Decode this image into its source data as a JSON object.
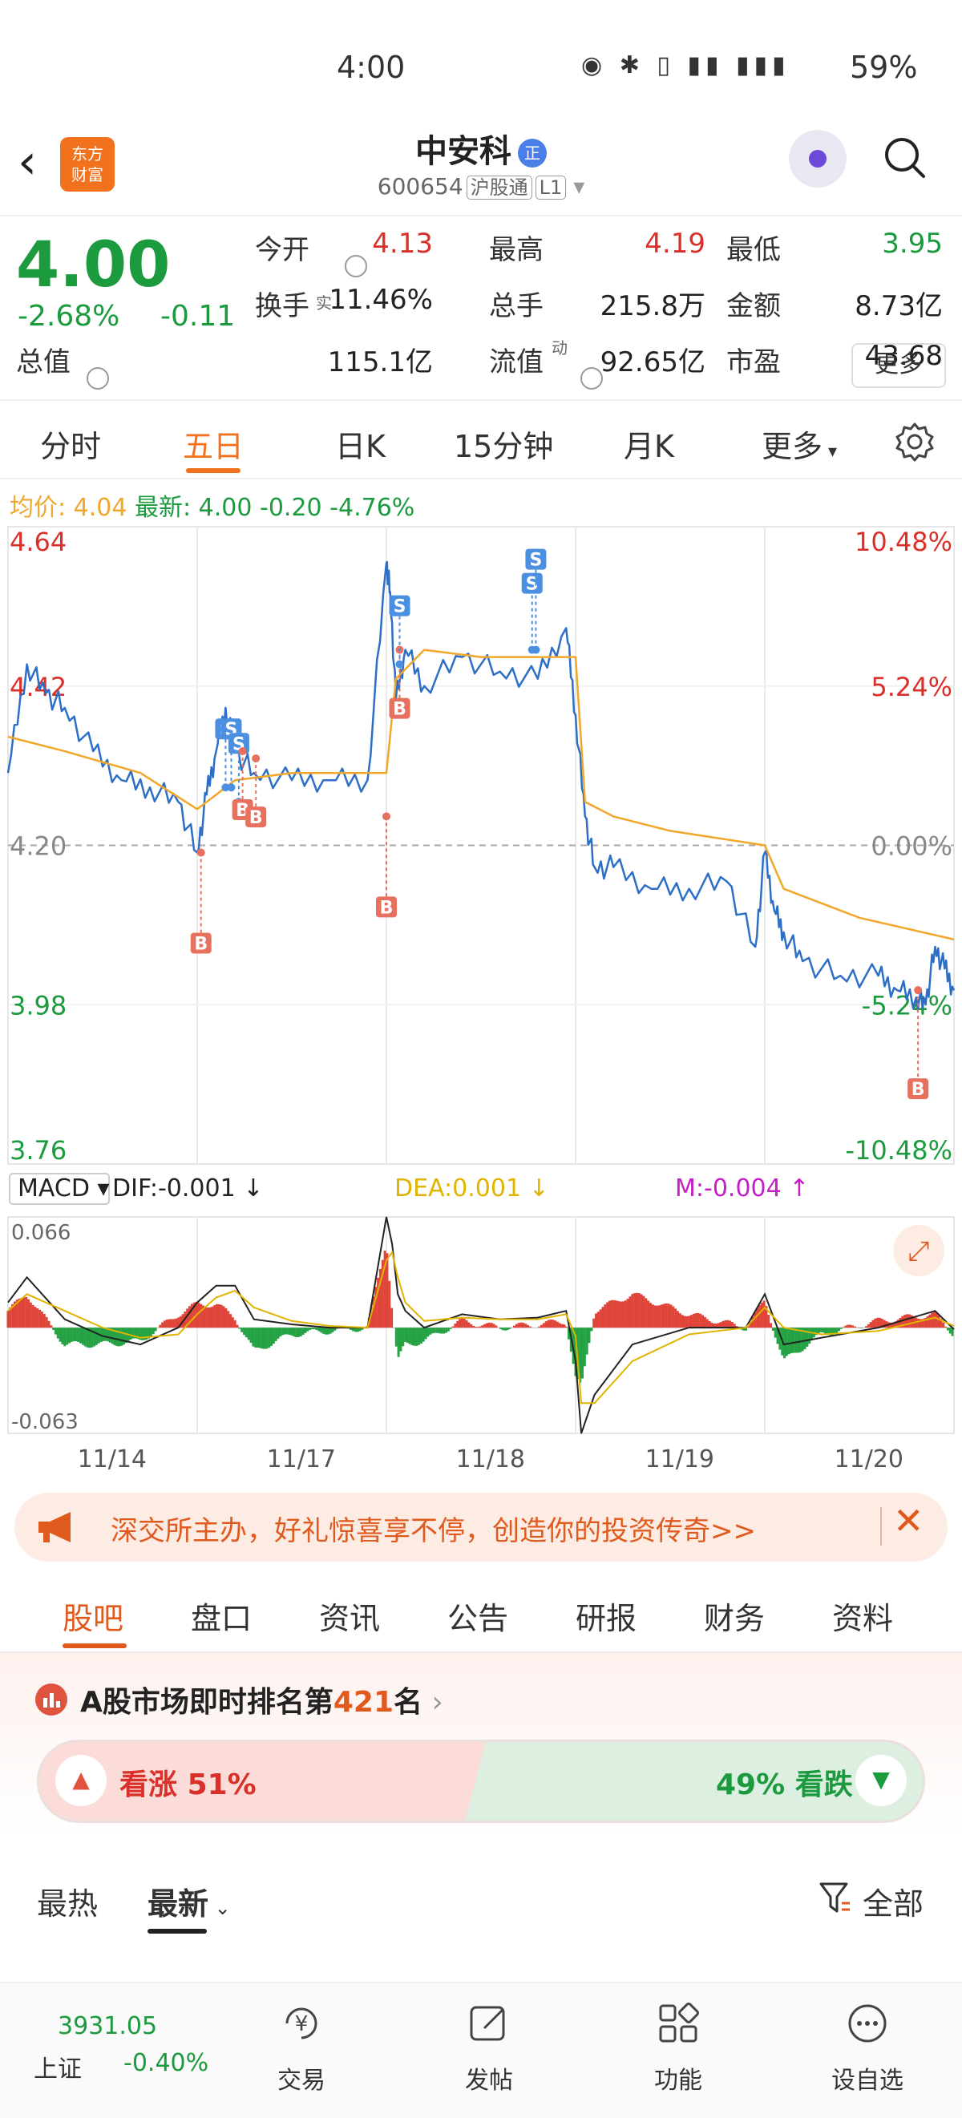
{
  "status_bar": {
    "time": "4:00",
    "icons": "◉ ✱ ▯ ▮▮ ▮▮▮",
    "battery": "59%"
  },
  "header": {
    "logo_line1": "东方",
    "logo_line2": "财富",
    "title": "中安科",
    "title_badge": "正",
    "code": "600654",
    "tag1": "沪股通",
    "tag2": "L1"
  },
  "quote": {
    "price": "4.00",
    "change_pct": "-2.68%",
    "change": "-0.11",
    "fields": [
      {
        "label": "今开",
        "value": "4.13",
        "color": "red"
      },
      {
        "label": "最高",
        "value": "4.19",
        "color": "red"
      },
      {
        "label": "最低",
        "value": "3.95",
        "color": "green"
      },
      {
        "label": "换手",
        "value": "11.46%",
        "color": "black"
      },
      {
        "label": "总手",
        "value": "215.8万",
        "color": "black"
      },
      {
        "label": "金额",
        "value": "8.73亿",
        "color": "black"
      },
      {
        "label": "总值",
        "value": "115.1亿",
        "color": "black"
      },
      {
        "label": "流值",
        "value": "92.65亿",
        "color": "black"
      },
      {
        "label": "市盈",
        "value": "43.68",
        "color": "black"
      }
    ],
    "sup_real": "实",
    "sup_dyn": "动",
    "more": "更多"
  },
  "period_tabs": [
    "分时",
    "五日",
    "日K",
    "15分钟",
    "月K",
    "更多"
  ],
  "period_active": 1,
  "avg_line": {
    "avg_label": "均价:",
    "avg_value": "4.04",
    "latest_label": "最新:",
    "latest_value": "4.00",
    "latest_change": "-0.20",
    "latest_pct": "-4.76%"
  },
  "chart_data": {
    "type": "line",
    "title": "",
    "price_axis": {
      "left_labels": [
        "4.64",
        "4.42",
        "4.20",
        "3.98",
        "3.76"
      ],
      "right_labels": [
        "10.48%",
        "5.24%",
        "0.00%",
        "-5.24%",
        "-10.48%"
      ],
      "ylim": [
        3.76,
        4.64
      ],
      "ref": 4.2
    },
    "x_labels": [
      "11/14",
      "11/17",
      "11/18",
      "11/19",
      "11/20"
    ],
    "series": [
      {
        "name": "最新",
        "x": [
          0,
          0.1,
          0.2,
          0.3,
          0.45,
          0.6,
          0.75,
          0.9,
          1.0,
          1.05,
          1.1,
          1.15,
          1.2,
          1.3,
          1.5,
          1.7,
          1.9,
          2.0,
          2.02,
          2.05,
          2.1,
          2.2,
          2.4,
          2.6,
          2.8,
          2.95,
          3.0,
          3.05,
          3.1,
          3.2,
          3.4,
          3.6,
          3.8,
          3.95,
          4.0,
          4.05,
          4.1,
          4.2,
          4.4,
          4.6,
          4.7,
          4.8,
          4.85,
          4.9,
          4.95,
          5.0
        ],
        "y": [
          4.3,
          4.45,
          4.41,
          4.39,
          4.33,
          4.29,
          4.28,
          4.26,
          4.19,
          4.27,
          4.33,
          4.39,
          4.33,
          4.3,
          4.29,
          4.29,
          4.29,
          4.59,
          4.55,
          4.4,
          4.47,
          4.42,
          4.46,
          4.44,
          4.43,
          4.5,
          4.38,
          4.24,
          4.17,
          4.17,
          4.14,
          4.14,
          4.15,
          4.06,
          4.19,
          4.11,
          4.08,
          4.04,
          4.02,
          4.02,
          4.0,
          3.99,
          3.98,
          4.06,
          4.03,
          4.0
        ]
      },
      {
        "name": "均价",
        "x": [
          0,
          0.3,
          0.7,
          1.0,
          1.2,
          1.5,
          2.0,
          2.05,
          2.2,
          2.5,
          3.0,
          3.05,
          3.2,
          3.5,
          4.0,
          4.1,
          4.5,
          5.0
        ],
        "y": [
          4.35,
          4.33,
          4.3,
          4.25,
          4.29,
          4.3,
          4.3,
          4.43,
          4.47,
          4.46,
          4.46,
          4.26,
          4.24,
          4.22,
          4.2,
          4.14,
          4.1,
          4.07
        ]
      }
    ],
    "trades": [
      {
        "type": "B",
        "x": 1.02,
        "y": 4.19
      },
      {
        "type": "S",
        "x": 1.15,
        "y": 4.28
      },
      {
        "type": "S",
        "x": 1.18,
        "y": 4.28
      },
      {
        "type": "S",
        "x": 1.22,
        "y": 4.26
      },
      {
        "type": "B",
        "x": 1.24,
        "y": 4.33
      },
      {
        "type": "B",
        "x": 1.31,
        "y": 4.32
      },
      {
        "type": "B",
        "x": 2.0,
        "y": 4.24
      },
      {
        "type": "B",
        "x": 2.07,
        "y": 4.47
      },
      {
        "type": "S",
        "x": 2.07,
        "y": 4.45
      },
      {
        "type": "S",
        "x": 2.77,
        "y": 4.47
      },
      {
        "type": "S",
        "x": 2.79,
        "y": 4.47
      },
      {
        "type": "B",
        "x": 4.81,
        "y": 4.0
      }
    ],
    "macd": {
      "indicator": "MACD",
      "dif_label": "DIF:-0.001",
      "dea_label": "DEA:0.001",
      "m_label": "M:-0.004",
      "ymax_label": "0.066",
      "ymin_label": "-0.063",
      "ylim": [
        -0.063,
        0.066
      ],
      "x": [
        0,
        0.1,
        0.3,
        0.5,
        0.7,
        0.9,
        1.0,
        1.1,
        1.2,
        1.3,
        1.5,
        1.7,
        1.9,
        2.0,
        2.03,
        2.06,
        2.1,
        2.2,
        2.4,
        2.6,
        2.8,
        2.95,
        3.0,
        3.03,
        3.1,
        3.3,
        3.6,
        3.9,
        4.0,
        4.1,
        4.3,
        4.6,
        4.9,
        5.0
      ],
      "dif": [
        0.015,
        0.03,
        0.005,
        -0.005,
        -0.01,
        0.0,
        0.015,
        0.025,
        0.025,
        0.005,
        0.002,
        0.0,
        0.0,
        0.066,
        0.05,
        0.02,
        0.01,
        0.0,
        0.008,
        0.005,
        0.006,
        0.01,
        -0.02,
        -0.063,
        -0.04,
        -0.01,
        0.0,
        0.0,
        0.02,
        -0.01,
        -0.006,
        0.0,
        0.01,
        -0.001
      ],
      "dea": [
        0.01,
        0.02,
        0.01,
        0.0,
        -0.006,
        -0.004,
        0.008,
        0.018,
        0.022,
        0.012,
        0.004,
        0.001,
        0.0,
        0.04,
        0.045,
        0.03,
        0.015,
        0.004,
        0.006,
        0.005,
        0.005,
        0.008,
        -0.005,
        -0.045,
        -0.045,
        -0.02,
        -0.004,
        0.0,
        0.012,
        0.0,
        -0.004,
        -0.002,
        0.006,
        0.001
      ]
    }
  },
  "ad": {
    "text": "深交所主办，好礼惊喜享不停，创造你的投资传奇>>"
  },
  "info_tabs": [
    "股吧",
    "盘口",
    "资讯",
    "公告",
    "研报",
    "财务",
    "资料"
  ],
  "info_active": 0,
  "rank": {
    "prefix": "A股市场即时排名第",
    "number": "421",
    "suffix": "名"
  },
  "vote": {
    "up_label": "看涨",
    "up_pct": "51%",
    "down_pct": "49%",
    "down_label": "看跌",
    "up_ratio": 0.51
  },
  "feed_tabs": {
    "hot": "最热",
    "latest": "最新",
    "filter": "全部"
  },
  "bottom_nav": {
    "index_value": "3931.05",
    "index_name": "上证",
    "index_change": "-0.40%",
    "items": [
      "交易",
      "发帖",
      "功能",
      "设自选"
    ]
  },
  "colors": {
    "up": "#d9302a",
    "down": "#1b9a3e",
    "accent": "#f2711c",
    "line": "#2d6fc7",
    "avg": "#f0a72a"
  }
}
